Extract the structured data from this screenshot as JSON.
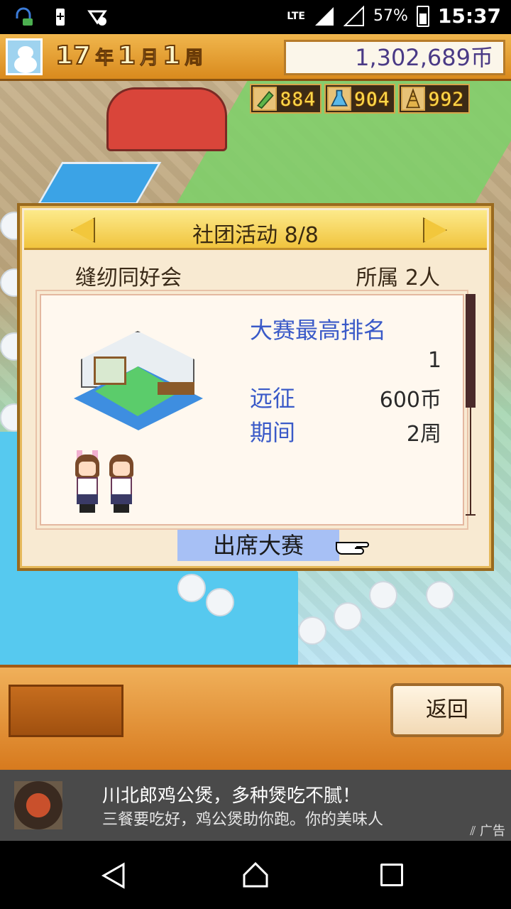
{
  "status_bar": {
    "network": "LTE",
    "battery_percent": "57%",
    "time": "15:37",
    "icons": [
      "headset-notification-icon",
      "battery-saver-icon",
      "data-saver-icon",
      "signal-icon",
      "no-signal-icon",
      "battery-icon"
    ]
  },
  "hud_top": {
    "year_num": "17",
    "year_unit": "年",
    "month_num": "1",
    "month_unit": "月",
    "week_num": "1",
    "week_unit": "周",
    "money": "1,302,689币"
  },
  "resources": [
    {
      "icon": "pencil-icon",
      "value": "884"
    },
    {
      "icon": "flask-icon",
      "value": "904"
    },
    {
      "icon": "tower-icon",
      "value": "992"
    }
  ],
  "dialog": {
    "title": "社团活动 8/8",
    "club_name": "缝纫同好会",
    "members": "所属 2人",
    "info": {
      "best_rank_label": "大赛最高排名",
      "best_rank_value": "1",
      "expedition_label": "远征",
      "expedition_value": "600币",
      "period_label": "期间",
      "period_value": "2周"
    },
    "attend_button": "出席大赛"
  },
  "hud_bottom": {
    "back_button": "返回"
  },
  "ad": {
    "title": "川北郎鸡公煲，多种煲吃不腻！",
    "body": "三餐要吃好，鸡公煲助你跑。你的美味人",
    "tag": "广告"
  }
}
